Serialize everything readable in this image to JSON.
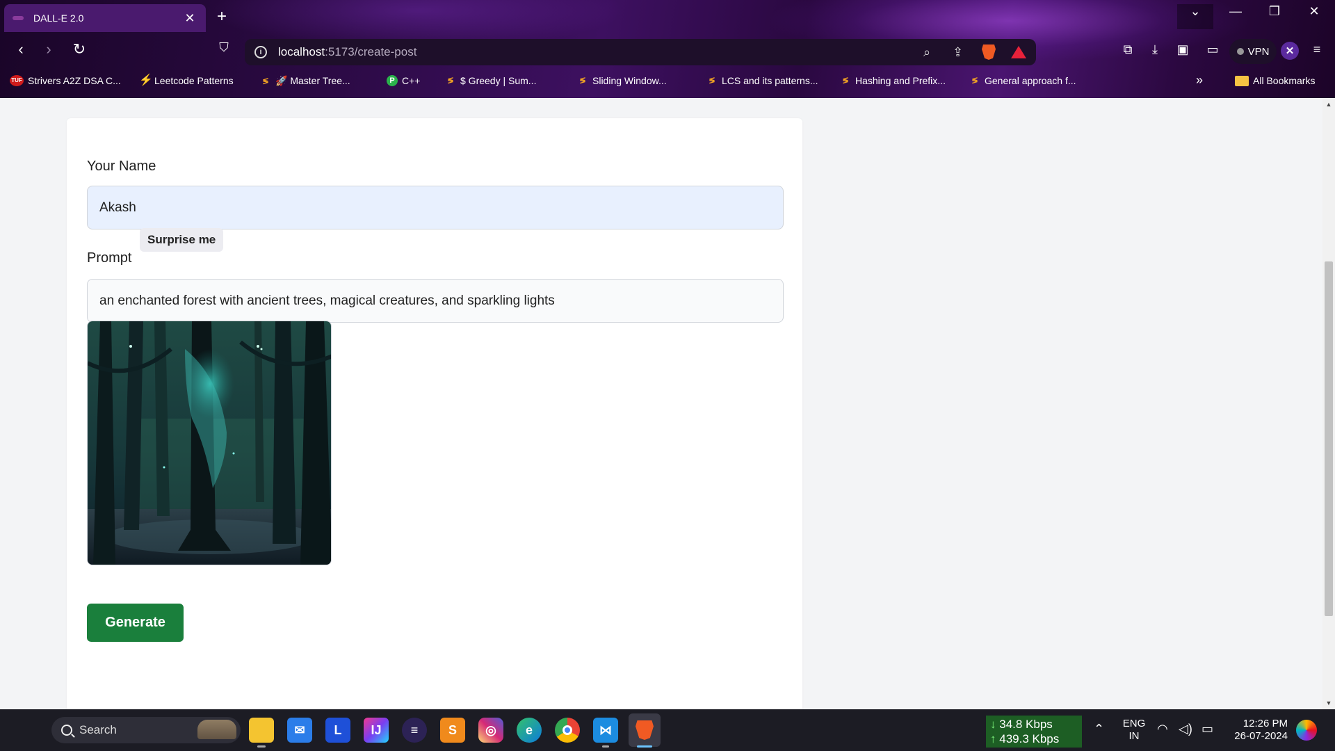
{
  "browser": {
    "tab": {
      "title": "DALL-E 2.0",
      "close": "✕"
    },
    "new_tab": "+",
    "window_controls": {
      "tab_search": "⌄",
      "minimize": "—",
      "restore": "❐",
      "close": "✕"
    },
    "url": {
      "host": "localhost",
      "path": ":5173/create-post"
    },
    "vpn_label": "VPN",
    "bookmarks": [
      {
        "label": "Strivers A2Z DSA C...",
        "icon": "tuf-icon"
      },
      {
        "label": "Leetcode Patterns",
        "icon": "leetcode-icon"
      },
      {
        "label": "🚀 Master Tree...",
        "icon": "leetcode-icon"
      },
      {
        "label": "C++",
        "icon": "green-shield-icon"
      },
      {
        "label": "$ Greedy | Sum...",
        "icon": "leetcode-icon"
      },
      {
        "label": "Sliding Window...",
        "icon": "leetcode-icon"
      },
      {
        "label": "LCS and its patterns...",
        "icon": "leetcode-icon"
      },
      {
        "label": "Hashing and Prefix...",
        "icon": "leetcode-icon"
      },
      {
        "label": "General approach f...",
        "icon": "leetcode-icon"
      }
    ],
    "more_bookmarks": "»",
    "all_bookmarks": "All Bookmarks"
  },
  "form": {
    "name_label": "Your Name",
    "name_value": "Akash",
    "prompt_label": "Prompt",
    "surprise_label": "Surprise me",
    "prompt_value": "an enchanted forest with ancient trees, magical creatures, and sparkling lights",
    "generate_label": "Generate"
  },
  "taskbar": {
    "search_placeholder": "Search",
    "net_down": "34.8 Kbps",
    "net_up": "439.3 Kbps",
    "lang_line1": "ENG",
    "lang_line2": "IN",
    "time": "12:26 PM",
    "date": "26-07-2024",
    "apps": [
      "file-explorer",
      "mail",
      "lark",
      "intellij",
      "eclipse",
      "sublime",
      "instagram",
      "edge",
      "chrome",
      "vscode",
      "brave"
    ]
  },
  "colors": {
    "generate_button": "#1a7f3c",
    "name_input_bg": "#e8f0fe",
    "page_bg": "#f3f4f6"
  }
}
